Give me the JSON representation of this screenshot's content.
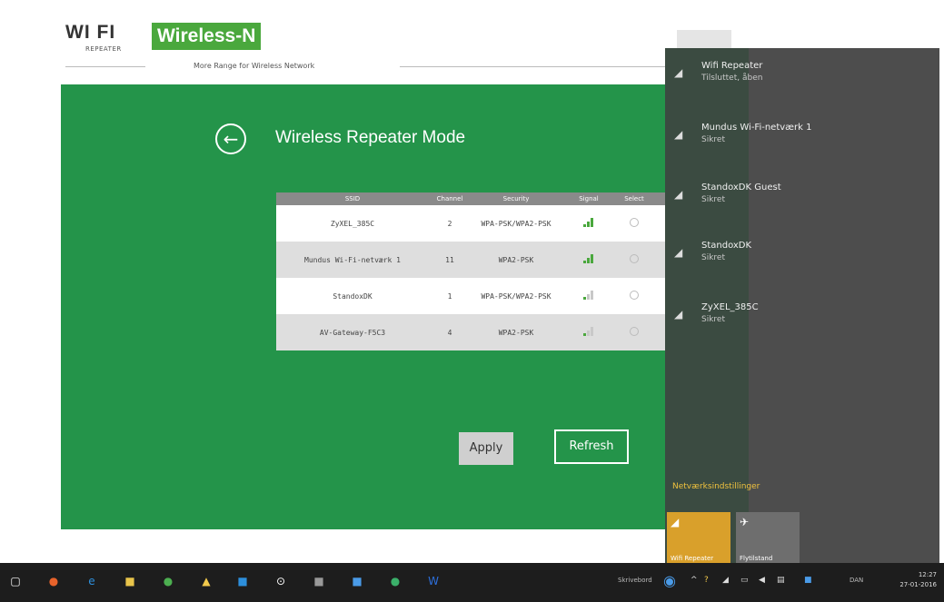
{
  "header": {
    "logo_text": "WI FI",
    "logo_sub": "REPEATER",
    "brand": "Wireless-N",
    "tagline": "More Range for Wireless Network"
  },
  "main": {
    "title": "Wireless Repeater Mode",
    "columns": [
      "SSID",
      "Channel",
      "Security",
      "Signal",
      "Select"
    ],
    "rows": [
      {
        "ssid": "ZyXEL_385C",
        "channel": "2",
        "security": "WPA-PSK/WPA2-PSK",
        "signal_level": 3
      },
      {
        "ssid": "Mundus Wi-Fi-netværk 1",
        "channel": "11",
        "security": "WPA2-PSK",
        "signal_level": 3
      },
      {
        "ssid": "StandoxDK",
        "channel": "1",
        "security": "WPA-PSK/WPA2-PSK",
        "signal_level": 1
      },
      {
        "ssid": "AV-Gateway-F5C3",
        "channel": "4",
        "security": "WPA2-PSK",
        "signal_level": 1
      }
    ],
    "apply_label": "Apply",
    "refresh_label": "Refresh"
  },
  "flyout": {
    "networks": [
      {
        "name": "Wifi Repeater",
        "status": "Tilsluttet, åben"
      },
      {
        "name": "Mundus Wi-Fi-netværk 1",
        "status": "Sikret"
      },
      {
        "name": "StandoxDK Guest",
        "status": "Sikret"
      },
      {
        "name": "StandoxDK",
        "status": "Sikret"
      },
      {
        "name": "ZyXEL_385C",
        "status": "Sikret"
      }
    ],
    "settings_link": "Netværksindstillinger",
    "tiles": [
      {
        "label": "Wifi Repeater"
      },
      {
        "label": "Flytilstand"
      }
    ]
  },
  "taskbar": {
    "tray_label": "Skrivebord",
    "lang": "DAN",
    "time": "12:27",
    "date": "27-01-2016"
  },
  "colors": {
    "panel_green": "#24944a",
    "brand_green": "#4aa83d",
    "flyout_bg": "#4d4d4d",
    "tile_active": "#d9a02b"
  }
}
